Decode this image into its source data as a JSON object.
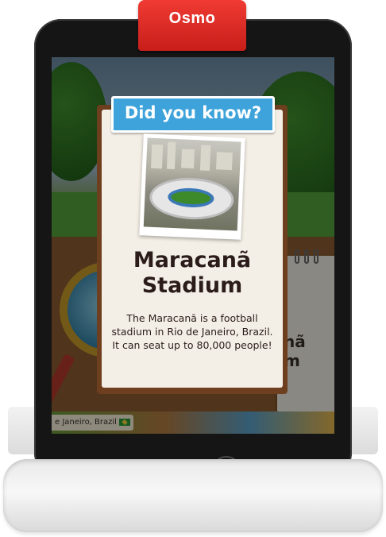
{
  "brand": {
    "clip_label": "Osmo",
    "clip_color": "#e5302a"
  },
  "card": {
    "banner_title": "Did you know?",
    "banner_color": "#3ea3da",
    "photo_icon": "stadium-photo",
    "title_line1": "Maracanã",
    "title_line2": "Stadium",
    "body": "The Maracanã is a football stadium in Rio de Janeiro, Brazil.  It can seat up to 80,000 people!"
  },
  "background": {
    "notepad_line1": "nã",
    "notepad_line2": "m",
    "location_label": "e Janeiro, Brazil",
    "location_flag_icon": "brazil-flag-icon"
  }
}
